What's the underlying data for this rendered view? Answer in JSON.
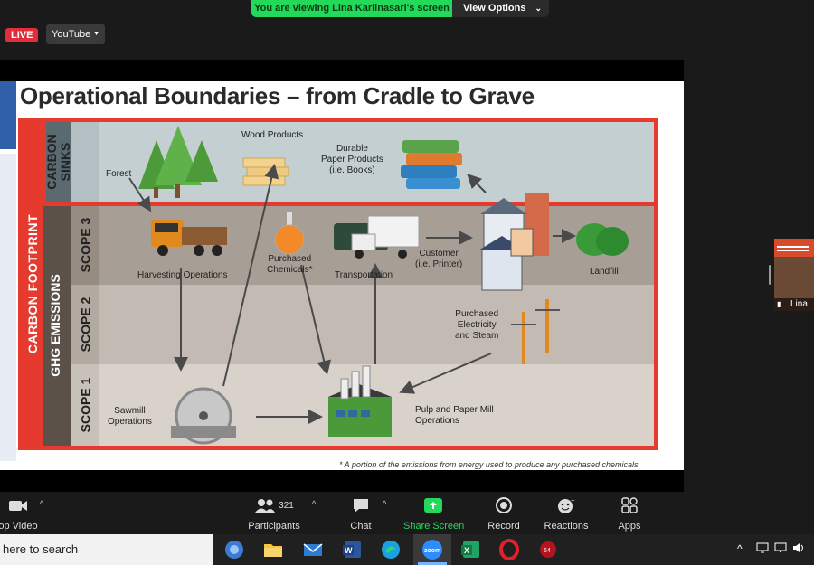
{
  "banner": {
    "text": "You are viewing Lina Karlinasari's screen",
    "button": "View Options"
  },
  "live": {
    "badge": "LIVE",
    "stream": "YouTube"
  },
  "slide": {
    "title": "Operational Boundaries – from Cradle to Grave",
    "side_label": "CARBON FOOTPRINT",
    "ghg_label": "GHG EMISSIONS",
    "bands": {
      "sinks": "CARBON\nSINKS",
      "scope3": "SCOPE 3",
      "scope2": "SCOPE 2",
      "scope1": "SCOPE 1"
    },
    "labels": {
      "forest": "Forest",
      "wood_products": "Wood Products",
      "durable": "Durable\nPaper Products\n(i.e. Books)",
      "harvesting": "Harvesting Operations",
      "chemicals": "Purchased\nChemicals*",
      "transportation": "Transportation",
      "customer": "Customer\n(i.e. Printer)",
      "landfill": "Landfill",
      "electricity": "Purchased\nElectricity\nand Steam",
      "sawmill": "Sawmill\nOperations",
      "pulp": "Pulp and Paper Mill\nOperations"
    },
    "footnote": "* A portion of the emissions from energy used to produce any purchased chemicals"
  },
  "participant": {
    "name": "Lina"
  },
  "toolbar": {
    "video": "op Video",
    "participants_label": "Participants",
    "participants_count": "321",
    "chat": "Chat",
    "share": "Share Screen",
    "record": "Record",
    "reactions": "Reactions",
    "apps": "Apps"
  },
  "taskbar": {
    "search": "here to search"
  },
  "colors": {
    "banner_green": "#23d95a",
    "frame_red": "#e63a2e",
    "share_green": "#23d95a"
  }
}
